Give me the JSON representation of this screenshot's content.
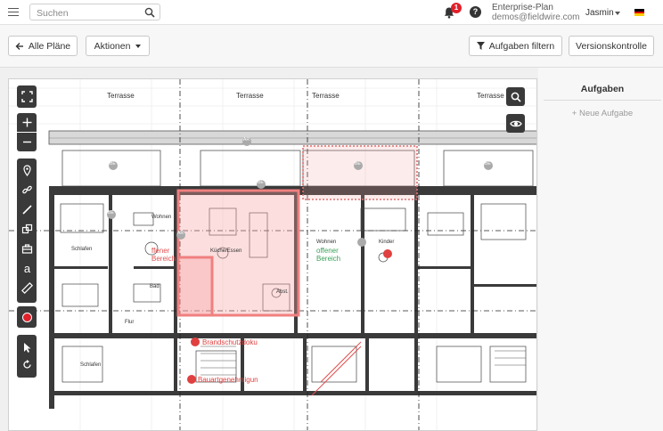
{
  "topbar": {
    "search_placeholder": "Suchen",
    "notification_count": "1",
    "help_label": "?",
    "plan_name": "Enterprise-Plan",
    "user_email": "demos@fieldwire.com",
    "user_name": "Jasmin"
  },
  "toolbar": {
    "back_label": "Alle Pläne",
    "actions_label": "Aktionen",
    "filter_label": "Aufgaben filtern",
    "version_label": "Versionskontrolle"
  },
  "sidepanel": {
    "title": "Aufgaben",
    "new_task": "+ Neue Aufgabe"
  },
  "plan": {
    "area_left_line1": "ffener",
    "area_left_line2": "Bereich",
    "area_right_line1": "offener",
    "area_right_line2": "Bereich",
    "doc_fire": "Brandschutzdoku",
    "doc_permit": "Bauartgenehmigun",
    "room_labels": [
      "Terrasse",
      "Terrasse",
      "Terrasse",
      "Terrasse",
      "Wohnen",
      "Schlafen",
      "Kinder",
      "Bad",
      "Flur",
      "Abst.",
      "Schlafen",
      "Küche/Essen",
      "Wohnen"
    ],
    "tag_labels": [
      "BE",
      "BE",
      "BE",
      "BE",
      "BE",
      "AR",
      "AR"
    ]
  },
  "colors": {
    "accent_red": "#e0202a",
    "highlight_red": "#f08080",
    "tool_dark": "#3a3a3a",
    "green_label": "#3aa05a"
  },
  "icons": {
    "menu": "menu-icon",
    "search": "search-icon",
    "bell": "bell-icon",
    "flag": "german-flag-icon"
  }
}
